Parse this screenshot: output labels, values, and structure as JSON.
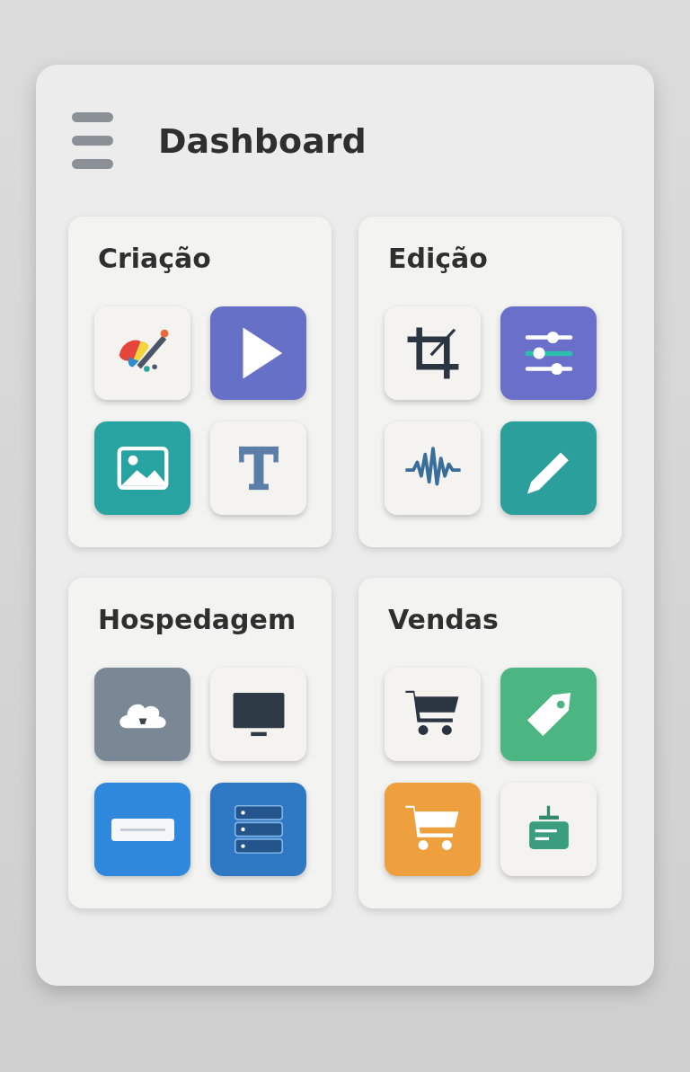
{
  "header": {
    "title": "Dashboard"
  },
  "groups": [
    {
      "title": "Criação",
      "tiles": [
        {
          "kind": "palette",
          "color": "#f4f3f0"
        },
        {
          "kind": "play",
          "color": "#6670c6"
        },
        {
          "kind": "image",
          "color": "#27a3a2"
        },
        {
          "kind": "text",
          "color": "#f4f3f0"
        }
      ]
    },
    {
      "title": "Edição",
      "tiles": [
        {
          "kind": "crop",
          "color": "#f4f3f0"
        },
        {
          "kind": "sliders",
          "color": "#6a6fca"
        },
        {
          "kind": "wave",
          "color": "#f4f3f0"
        },
        {
          "kind": "pencil",
          "color": "#2a9f9b"
        }
      ]
    },
    {
      "title": "Hospedagem",
      "tiles": [
        {
          "kind": "cloud",
          "color": "#7a8896"
        },
        {
          "kind": "monitor",
          "color": "#f4f3f0"
        },
        {
          "kind": "drive",
          "color": "#3088dc"
        },
        {
          "kind": "server",
          "color": "#2f79c4"
        }
      ]
    },
    {
      "title": "Vendas",
      "tiles": [
        {
          "kind": "cart",
          "color": "#f4f3f0"
        },
        {
          "kind": "tag",
          "color": "#4cb683"
        },
        {
          "kind": "cart-light",
          "color": "#eea03f"
        },
        {
          "kind": "device",
          "color": "#f4f3f0"
        }
      ]
    }
  ]
}
